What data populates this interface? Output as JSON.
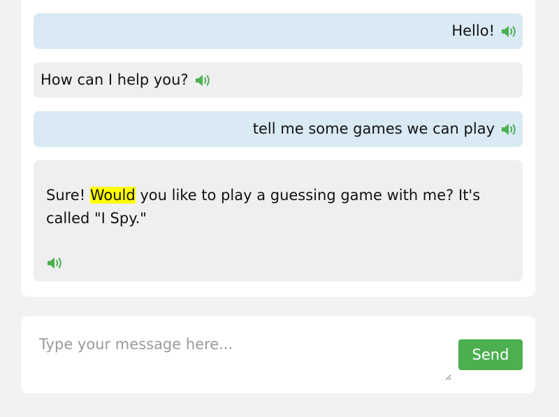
{
  "messages": [
    {
      "role": "user",
      "text": "Hello!"
    },
    {
      "role": "bot",
      "text": "How can I help you?"
    },
    {
      "role": "user",
      "text": "tell me some games we can play"
    },
    {
      "role": "bot",
      "parts": {
        "before": "Sure! ",
        "highlighted": "Would",
        "after": " you like to play a guessing game with me? It's called \"I Spy.\""
      }
    }
  ],
  "composer": {
    "placeholder": "Type your message here...",
    "send_label": "Send"
  },
  "colors": {
    "user_bubble": "#d9eaf5",
    "bot_bubble": "#efefef",
    "speaker_icon": "#4caf50",
    "send_button": "#4caf50",
    "highlight": "#ffff00"
  },
  "icons": {
    "speaker": "speaker-icon"
  }
}
